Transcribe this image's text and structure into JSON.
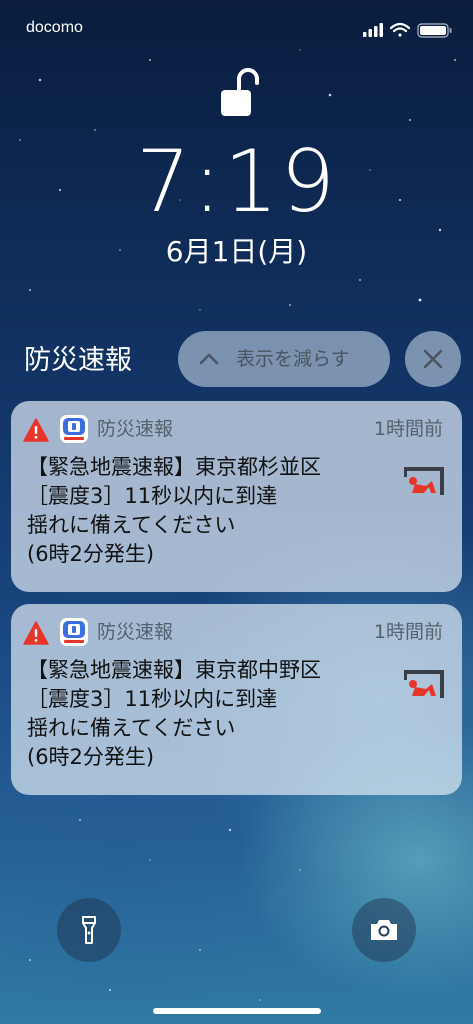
{
  "status_bar": {
    "carrier": "docomo",
    "icons": [
      "cellular-signal-icon",
      "wifi-icon",
      "battery-icon"
    ]
  },
  "lock_screen": {
    "lock_state_icon": "unlocked-padlock-icon",
    "time": "7:19",
    "date": "6月1日(月)"
  },
  "notification_group": {
    "title": "防災速報",
    "show_less_label": "表示を減らす",
    "clear_icon": "close-icon"
  },
  "notifications": [
    {
      "app_name": "防災速報",
      "time": "1時間前",
      "lines": [
        "【緊急地震速報】東京都杉並区",
        "［震度3］11秒以内に到達",
        "揺れに備えてください",
        "(6時2分発生)"
      ],
      "thumbnail_icon": "take-cover-icon",
      "alert_icon": "warning-triangle-icon",
      "alert_color": "#e8352a"
    },
    {
      "app_name": "防災速報",
      "time": "1時間前",
      "lines": [
        "【緊急地震速報】東京都中野区",
        "［震度3］11秒以内に到達",
        "揺れに備えてください",
        "(6時2分発生)"
      ],
      "thumbnail_icon": "take-cover-icon",
      "alert_icon": "warning-triangle-icon",
      "alert_color": "#e8352a"
    }
  ],
  "quick_actions": {
    "left": "flashlight-icon",
    "right": "camera-icon"
  }
}
